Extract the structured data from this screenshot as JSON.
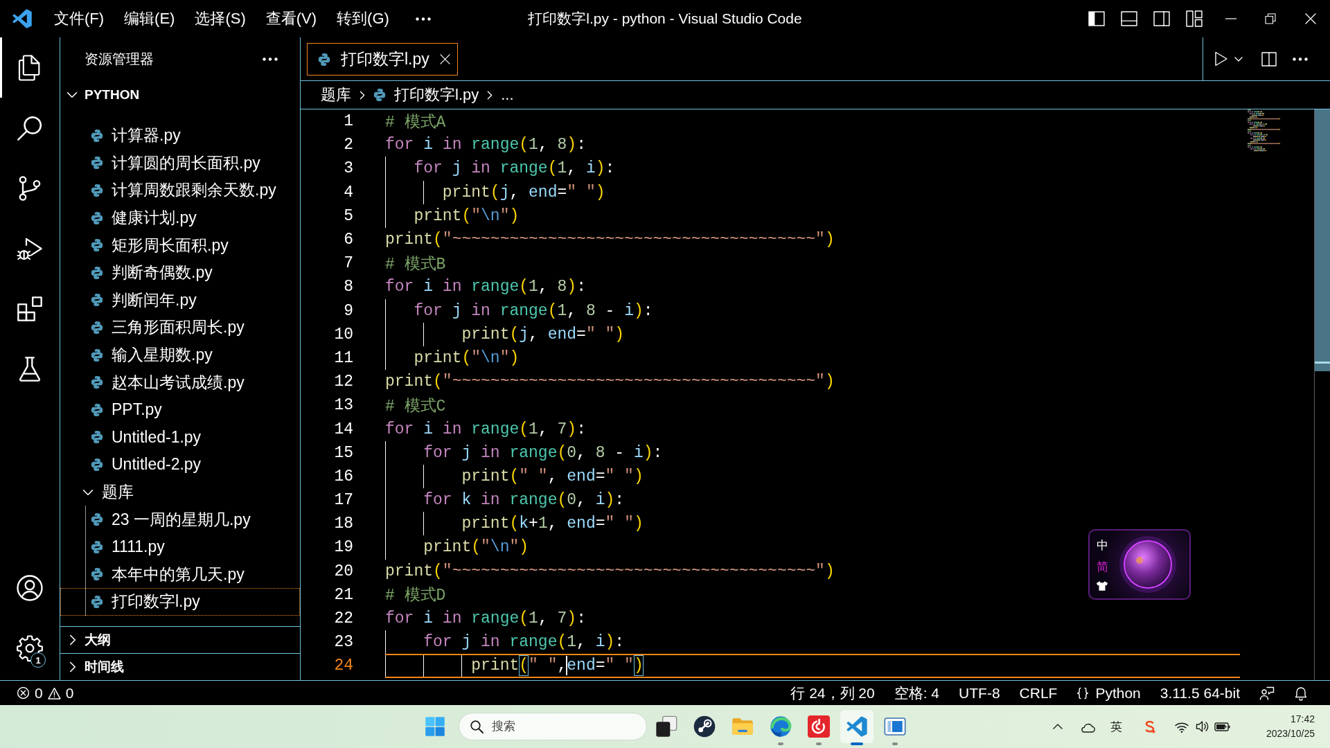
{
  "title_bar": {
    "menus": [
      "文件(F)",
      "编辑(E)",
      "选择(S)",
      "查看(V)",
      "转到(G)"
    ],
    "title": "打印数字l.py - python - Visual Studio Code"
  },
  "activity_bar": {
    "items": [
      {
        "kind": "files",
        "selected": true
      },
      {
        "kind": "search",
        "selected": false
      },
      {
        "kind": "source-control",
        "selected": false
      },
      {
        "kind": "run-debug",
        "selected": false
      },
      {
        "kind": "extensions",
        "selected": false
      },
      {
        "kind": "testing",
        "selected": false
      }
    ],
    "bottom": [
      {
        "kind": "account"
      },
      {
        "kind": "settings",
        "badge": "1"
      }
    ]
  },
  "sidebar": {
    "title": "资源管理器",
    "section": {
      "label": "PYTHON",
      "expanded": true
    },
    "tree": [
      {
        "kind": "file",
        "label": "计算器.py",
        "selected": false
      },
      {
        "kind": "file",
        "label": "计算圆的周长面积.py",
        "selected": false
      },
      {
        "kind": "file",
        "label": "计算周数跟剩余天数.py",
        "selected": false
      },
      {
        "kind": "file",
        "label": "健康计划.py",
        "selected": false
      },
      {
        "kind": "file",
        "label": "矩形周长面积.py",
        "selected": false
      },
      {
        "kind": "file",
        "label": "判断奇偶数.py",
        "selected": false
      },
      {
        "kind": "file",
        "label": "判断闰年.py",
        "selected": false
      },
      {
        "kind": "file",
        "label": "三角形面积周长.py",
        "selected": false
      },
      {
        "kind": "file",
        "label": "输入星期数.py",
        "selected": false
      },
      {
        "kind": "file",
        "label": "赵本山考试成绩.py",
        "selected": false
      },
      {
        "kind": "file",
        "label": "PPT.py",
        "selected": false
      },
      {
        "kind": "file",
        "label": "Untitled-1.py",
        "selected": false
      },
      {
        "kind": "file",
        "label": "Untitled-2.py",
        "selected": false
      },
      {
        "kind": "folder",
        "label": "题库",
        "expanded": true,
        "selected": false,
        "children": [
          {
            "kind": "file",
            "label": "23 一周的星期几.py",
            "selected": false
          },
          {
            "kind": "file",
            "label": "1111.py",
            "selected": false
          },
          {
            "kind": "file",
            "label": "本年中的第几天.py",
            "selected": false
          },
          {
            "kind": "file",
            "label": "打印数字l.py",
            "selected": true
          }
        ]
      }
    ],
    "panels": [
      {
        "label": "大纲",
        "expanded": false
      },
      {
        "label": "时间线",
        "expanded": false
      }
    ]
  },
  "editor": {
    "tabs": [
      {
        "label": "打印数字l.py",
        "selected": true
      }
    ],
    "breadcrumbs": [
      {
        "kind": "folder",
        "label": "题库"
      },
      {
        "kind": "file",
        "label": "打印数字l.py"
      },
      {
        "kind": "symbol",
        "label": "..."
      }
    ],
    "lines": [
      {
        "number": "1",
        "current": false,
        "tokens": [
          {
            "kind": "comment",
            "text": "# 模式A"
          }
        ]
      },
      {
        "number": "2",
        "current": false,
        "tokens": [
          {
            "kind": "kw",
            "text": "for "
          },
          {
            "kind": "var",
            "text": "i "
          },
          {
            "kind": "kw",
            "text": "in "
          },
          {
            "kind": "cls",
            "text": "range"
          },
          {
            "kind": "paren",
            "text": "("
          },
          {
            "kind": "num",
            "text": "1"
          },
          {
            "kind": "punct",
            "text": ", "
          },
          {
            "kind": "num",
            "text": "8"
          },
          {
            "kind": "paren",
            "text": ")"
          },
          {
            "kind": "punct",
            "text": ":"
          }
        ]
      },
      {
        "number": "3",
        "current": false,
        "tokens": [
          {
            "kind": "kw",
            "text": "   for "
          },
          {
            "kind": "var",
            "text": "j "
          },
          {
            "kind": "kw",
            "text": "in "
          },
          {
            "kind": "cls",
            "text": "range"
          },
          {
            "kind": "paren",
            "text": "("
          },
          {
            "kind": "num",
            "text": "1"
          },
          {
            "kind": "punct",
            "text": ", "
          },
          {
            "kind": "var",
            "text": "i"
          },
          {
            "kind": "paren",
            "text": ")"
          },
          {
            "kind": "punct",
            "text": ":"
          }
        ]
      },
      {
        "number": "4",
        "current": false,
        "tokens": [
          {
            "kind": "fn",
            "text": "      print"
          },
          {
            "kind": "paren",
            "text": "("
          },
          {
            "kind": "var",
            "text": "j"
          },
          {
            "kind": "punct",
            "text": ", "
          },
          {
            "kind": "param",
            "text": "end"
          },
          {
            "kind": "punct",
            "text": "="
          },
          {
            "kind": "str",
            "text": "\" \""
          },
          {
            "kind": "paren",
            "text": ")"
          }
        ]
      },
      {
        "number": "5",
        "current": false,
        "tokens": [
          {
            "kind": "fn",
            "text": "   print"
          },
          {
            "kind": "paren",
            "text": "("
          },
          {
            "kind": "str",
            "text": "\""
          },
          {
            "kind": "esc",
            "text": "\\n"
          },
          {
            "kind": "str",
            "text": "\""
          },
          {
            "kind": "paren",
            "text": ")"
          }
        ]
      },
      {
        "number": "6",
        "current": false,
        "tokens": [
          {
            "kind": "fn",
            "text": "print"
          },
          {
            "kind": "paren",
            "text": "("
          },
          {
            "kind": "str",
            "text": "\"~~~~~~~~~~~~~~~~~~~~~~~~~~~~~~~~~~~~~~\""
          },
          {
            "kind": "paren",
            "text": ")"
          }
        ]
      },
      {
        "number": "7",
        "current": false,
        "tokens": [
          {
            "kind": "comment",
            "text": "# 模式B"
          }
        ]
      },
      {
        "number": "8",
        "current": false,
        "tokens": [
          {
            "kind": "kw",
            "text": "for "
          },
          {
            "kind": "var",
            "text": "i "
          },
          {
            "kind": "kw",
            "text": "in "
          },
          {
            "kind": "cls",
            "text": "range"
          },
          {
            "kind": "paren",
            "text": "("
          },
          {
            "kind": "num",
            "text": "1"
          },
          {
            "kind": "punct",
            "text": ", "
          },
          {
            "kind": "num",
            "text": "8"
          },
          {
            "kind": "paren",
            "text": ")"
          },
          {
            "kind": "punct",
            "text": ":"
          }
        ]
      },
      {
        "number": "9",
        "current": false,
        "tokens": [
          {
            "kind": "kw",
            "text": "   for "
          },
          {
            "kind": "var",
            "text": "j "
          },
          {
            "kind": "kw",
            "text": "in "
          },
          {
            "kind": "cls",
            "text": "range"
          },
          {
            "kind": "paren",
            "text": "("
          },
          {
            "kind": "num",
            "text": "1"
          },
          {
            "kind": "punct",
            "text": ", "
          },
          {
            "kind": "num",
            "text": "8"
          },
          {
            "kind": "punct",
            "text": " - "
          },
          {
            "kind": "var",
            "text": "i"
          },
          {
            "kind": "paren",
            "text": ")"
          },
          {
            "kind": "punct",
            "text": ":"
          }
        ]
      },
      {
        "number": "10",
        "current": false,
        "tokens": [
          {
            "kind": "fn",
            "text": "        print"
          },
          {
            "kind": "paren",
            "text": "("
          },
          {
            "kind": "var",
            "text": "j"
          },
          {
            "kind": "punct",
            "text": ", "
          },
          {
            "kind": "param",
            "text": "end"
          },
          {
            "kind": "punct",
            "text": "="
          },
          {
            "kind": "str",
            "text": "\" \""
          },
          {
            "kind": "paren",
            "text": ")"
          }
        ]
      },
      {
        "number": "11",
        "current": false,
        "tokens": [
          {
            "kind": "fn",
            "text": "   print"
          },
          {
            "kind": "paren",
            "text": "("
          },
          {
            "kind": "str",
            "text": "\""
          },
          {
            "kind": "esc",
            "text": "\\n"
          },
          {
            "kind": "str",
            "text": "\""
          },
          {
            "kind": "paren",
            "text": ")"
          }
        ]
      },
      {
        "number": "12",
        "current": false,
        "tokens": [
          {
            "kind": "fn",
            "text": "print"
          },
          {
            "kind": "paren",
            "text": "("
          },
          {
            "kind": "str",
            "text": "\"~~~~~~~~~~~~~~~~~~~~~~~~~~~~~~~~~~~~~~\""
          },
          {
            "kind": "paren",
            "text": ")"
          }
        ]
      },
      {
        "number": "13",
        "current": false,
        "tokens": [
          {
            "kind": "comment",
            "text": "# 模式C"
          }
        ]
      },
      {
        "number": "14",
        "current": false,
        "tokens": [
          {
            "kind": "kw",
            "text": "for "
          },
          {
            "kind": "var",
            "text": "i "
          },
          {
            "kind": "kw",
            "text": "in "
          },
          {
            "kind": "cls",
            "text": "range"
          },
          {
            "kind": "paren",
            "text": "("
          },
          {
            "kind": "num",
            "text": "1"
          },
          {
            "kind": "punct",
            "text": ", "
          },
          {
            "kind": "num",
            "text": "7"
          },
          {
            "kind": "paren",
            "text": ")"
          },
          {
            "kind": "punct",
            "text": ":"
          }
        ]
      },
      {
        "number": "15",
        "current": false,
        "tokens": [
          {
            "kind": "kw",
            "text": "    for "
          },
          {
            "kind": "var",
            "text": "j "
          },
          {
            "kind": "kw",
            "text": "in "
          },
          {
            "kind": "cls",
            "text": "range"
          },
          {
            "kind": "paren",
            "text": "("
          },
          {
            "kind": "num",
            "text": "0"
          },
          {
            "kind": "punct",
            "text": ", "
          },
          {
            "kind": "num",
            "text": "8"
          },
          {
            "kind": "punct",
            "text": " - "
          },
          {
            "kind": "var",
            "text": "i"
          },
          {
            "kind": "paren",
            "text": ")"
          },
          {
            "kind": "punct",
            "text": ":"
          }
        ]
      },
      {
        "number": "16",
        "current": false,
        "tokens": [
          {
            "kind": "fn",
            "text": "        print"
          },
          {
            "kind": "paren",
            "text": "("
          },
          {
            "kind": "str",
            "text": "\" \""
          },
          {
            "kind": "punct",
            "text": ", "
          },
          {
            "kind": "param",
            "text": "end"
          },
          {
            "kind": "punct",
            "text": "="
          },
          {
            "kind": "str",
            "text": "\" \""
          },
          {
            "kind": "paren",
            "text": ")"
          }
        ]
      },
      {
        "number": "17",
        "current": false,
        "tokens": [
          {
            "kind": "kw",
            "text": "    for "
          },
          {
            "kind": "var",
            "text": "k "
          },
          {
            "kind": "kw",
            "text": "in "
          },
          {
            "kind": "cls",
            "text": "range"
          },
          {
            "kind": "paren",
            "text": "("
          },
          {
            "kind": "num",
            "text": "0"
          },
          {
            "kind": "punct",
            "text": ", "
          },
          {
            "kind": "var",
            "text": "i"
          },
          {
            "kind": "paren",
            "text": ")"
          },
          {
            "kind": "punct",
            "text": ":"
          }
        ]
      },
      {
        "number": "18",
        "current": false,
        "tokens": [
          {
            "kind": "fn",
            "text": "        print"
          },
          {
            "kind": "paren",
            "text": "("
          },
          {
            "kind": "var",
            "text": "k"
          },
          {
            "kind": "punct",
            "text": "+"
          },
          {
            "kind": "num",
            "text": "1"
          },
          {
            "kind": "punct",
            "text": ", "
          },
          {
            "kind": "param",
            "text": "end"
          },
          {
            "kind": "punct",
            "text": "="
          },
          {
            "kind": "str",
            "text": "\" \""
          },
          {
            "kind": "paren",
            "text": ")"
          }
        ]
      },
      {
        "number": "19",
        "current": false,
        "tokens": [
          {
            "kind": "fn",
            "text": "    print"
          },
          {
            "kind": "paren",
            "text": "("
          },
          {
            "kind": "str",
            "text": "\""
          },
          {
            "kind": "esc",
            "text": "\\n"
          },
          {
            "kind": "str",
            "text": "\""
          },
          {
            "kind": "paren",
            "text": ")"
          }
        ]
      },
      {
        "number": "20",
        "current": false,
        "tokens": [
          {
            "kind": "fn",
            "text": "print"
          },
          {
            "kind": "paren",
            "text": "("
          },
          {
            "kind": "str",
            "text": "\"~~~~~~~~~~~~~~~~~~~~~~~~~~~~~~~~~~~~~~\""
          },
          {
            "kind": "paren",
            "text": ")"
          }
        ]
      },
      {
        "number": "21",
        "current": false,
        "tokens": [
          {
            "kind": "comment",
            "text": "# 模式D"
          }
        ]
      },
      {
        "number": "22",
        "current": false,
        "tokens": [
          {
            "kind": "kw",
            "text": "for "
          },
          {
            "kind": "var",
            "text": "i "
          },
          {
            "kind": "kw",
            "text": "in "
          },
          {
            "kind": "cls",
            "text": "range"
          },
          {
            "kind": "paren",
            "text": "("
          },
          {
            "kind": "num",
            "text": "1"
          },
          {
            "kind": "punct",
            "text": ", "
          },
          {
            "kind": "num",
            "text": "7"
          },
          {
            "kind": "paren",
            "text": ")"
          },
          {
            "kind": "punct",
            "text": ":"
          }
        ]
      },
      {
        "number": "23",
        "current": false,
        "tokens": [
          {
            "kind": "kw",
            "text": "    for "
          },
          {
            "kind": "var",
            "text": "j "
          },
          {
            "kind": "kw",
            "text": "in "
          },
          {
            "kind": "cls",
            "text": "range"
          },
          {
            "kind": "paren",
            "text": "("
          },
          {
            "kind": "num",
            "text": "1"
          },
          {
            "kind": "punct",
            "text": ", "
          },
          {
            "kind": "var",
            "text": "i"
          },
          {
            "kind": "paren",
            "text": ")"
          },
          {
            "kind": "punct",
            "text": ":"
          }
        ]
      },
      {
        "number": "24",
        "current": true,
        "tokens": [
          {
            "kind": "fn",
            "text": "         print"
          },
          {
            "kind": "match",
            "text": "("
          },
          {
            "kind": "str",
            "text": "\" \""
          },
          {
            "kind": "punct",
            "text": ","
          },
          {
            "kind": "cursor"
          },
          {
            "kind": "param",
            "text": "end"
          },
          {
            "kind": "punct",
            "text": "="
          },
          {
            "kind": "str",
            "text": "\" \""
          },
          {
            "kind": "match",
            "text": ")"
          }
        ]
      }
    ]
  },
  "status_bar": {
    "errors": "0",
    "warnings": "0",
    "position": "行 24，列 20",
    "indentation": "空格: 4",
    "encoding": "UTF-8",
    "line_ending": "CRLF",
    "language": "Python",
    "interpreter": "3.11.5 64-bit"
  },
  "ime": {
    "mode": "中",
    "charset": "简"
  },
  "taskbar": {
    "search": {
      "placeholder": "搜索"
    },
    "apps": [
      {
        "kind": "task-view",
        "running": false,
        "selected": false
      },
      {
        "kind": "circle-logo",
        "running": false,
        "selected": false
      },
      {
        "kind": "folder",
        "running": false,
        "selected": false
      },
      {
        "kind": "wave-logo",
        "running": true,
        "selected": false
      },
      {
        "kind": "swirl-tile",
        "running": true,
        "selected": false
      },
      {
        "kind": "ribbon-logo",
        "running": true,
        "selected": true
      },
      {
        "kind": "window-tile",
        "running": true,
        "selected": false
      }
    ],
    "tray": {
      "input_language": "英",
      "time": "17:42",
      "date": "2023/10/25"
    }
  }
}
